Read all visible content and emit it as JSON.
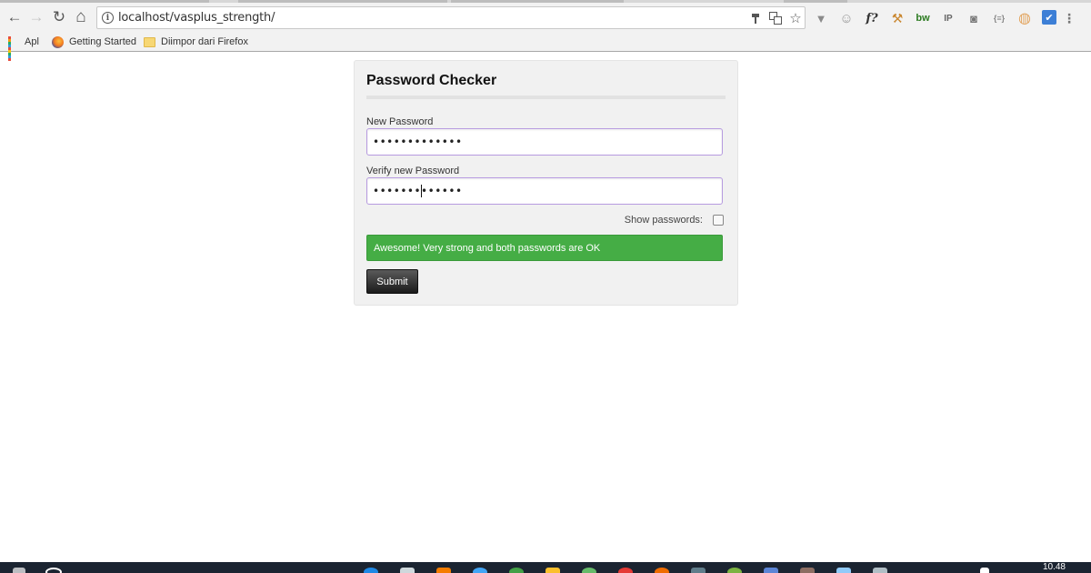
{
  "browser": {
    "url": "localhost/vasplus_strength/",
    "nav": {
      "back": "←",
      "forward": "→",
      "reload": "↻",
      "home": "⌂"
    },
    "omnibox_icons": [
      "key-icon",
      "translate-icon",
      "star-icon"
    ],
    "extensions": [
      {
        "name": "vue-devtools-icon",
        "glyph": "▼"
      },
      {
        "name": "smiley-icon",
        "glyph": "☺"
      },
      {
        "name": "font-icon",
        "glyph": "f?"
      },
      {
        "name": "hammer-icon",
        "glyph": "⚒"
      },
      {
        "name": "builtwith-icon",
        "glyph": "bw"
      },
      {
        "name": "ip-icon",
        "glyph": "IP"
      },
      {
        "name": "camera-icon",
        "glyph": "◙"
      },
      {
        "name": "json-icon",
        "glyph": "{≡}"
      },
      {
        "name": "cookie-icon",
        "glyph": "◍"
      },
      {
        "name": "check-extension-icon",
        "glyph": "✔"
      }
    ],
    "bookmarks": [
      {
        "label": "Apl"
      },
      {
        "label": "Getting Started"
      },
      {
        "label": "Diimpor dari Firefox"
      }
    ]
  },
  "panel": {
    "title": "Password Checker",
    "new_password_label": "New Password",
    "new_password_value": "•••••••••••••",
    "verify_password_label": "Verify new Password",
    "verify_password_value": "•••••••••••••",
    "show_passwords_label": "Show passwords:",
    "status_message": "Awesome! Very strong and both passwords are OK",
    "submit_label": "Submit"
  },
  "colors": {
    "status_green": "#45ad45",
    "input_focus_border": "#b79be0",
    "submit_dark": "#1b1b1b"
  },
  "taskbar": {
    "clock": "10.48"
  }
}
